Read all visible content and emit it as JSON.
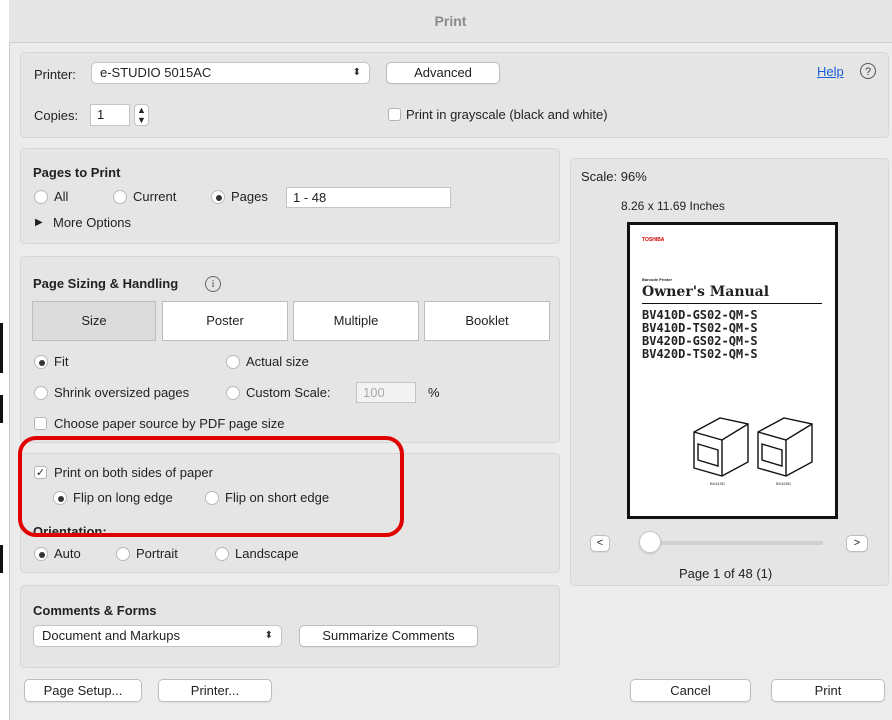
{
  "window": {
    "title": "Print"
  },
  "top": {
    "printer_label": "Printer:",
    "printer_value": "e-STUDIO 5015AC",
    "advanced_label": "Advanced",
    "help_label": "Help",
    "help_icon": "?",
    "copies_label": "Copies:",
    "copies_value": "1",
    "grayscale_label": "Print in grayscale (black and white)"
  },
  "pages": {
    "heading": "Pages to Print",
    "all_label": "All",
    "current_label": "Current",
    "pages_label": "Pages",
    "pages_value": "1 - 48",
    "more_options": "More Options",
    "more_options_icon": "▶"
  },
  "sizing": {
    "heading": "Page Sizing & Handling",
    "info_icon": "i",
    "tabs": [
      "Size",
      "Poster",
      "Multiple",
      "Booklet"
    ],
    "selected_tab": "Size",
    "fit_label": "Fit",
    "actual_size_label": "Actual size",
    "shrink_label": "Shrink oversized pages",
    "custom_scale_label": "Custom Scale:",
    "custom_scale_value": "100",
    "percent": "%",
    "paper_source_label": "Choose paper source by PDF page size"
  },
  "duplex": {
    "both_sides_label": "Print on both sides of paper",
    "check_glyph": "✓",
    "long_edge_label": "Flip on long edge",
    "short_edge_label": "Flip on short edge"
  },
  "orientation": {
    "heading": "Orientation:",
    "auto_label": "Auto",
    "portrait_label": "Portrait",
    "landscape_label": "Landscape"
  },
  "comments": {
    "heading": "Comments & Forms",
    "select_value": "Document and Markups",
    "summarize_label": "Summarize Comments"
  },
  "preview": {
    "scale": "Scale: 96%",
    "dimensions": "8.26 x 11.69 Inches",
    "doc_brand": "TOSHIBA",
    "doc_subtitle": "Barcode Printer",
    "doc_title": "Owner's Manual",
    "doc_models": [
      "BV410D-GS02-QM-S",
      "BV410D-TS02-QM-S",
      "BV420D-GS02-QM-S",
      "BV420D-TS02-QM-S"
    ],
    "printer_captions": [
      "BV410D",
      "BV420D"
    ],
    "prev_label": "<",
    "next_label": ">",
    "page_status": "Page 1 of 48 (1)",
    "slider_position": 0.0
  },
  "footer": {
    "page_setup_label": "Page Setup...",
    "printer_label": "Printer...",
    "cancel_label": "Cancel",
    "print_label": "Print"
  },
  "colors": {
    "highlight": "#e00000",
    "link": "#1a5fd6"
  }
}
